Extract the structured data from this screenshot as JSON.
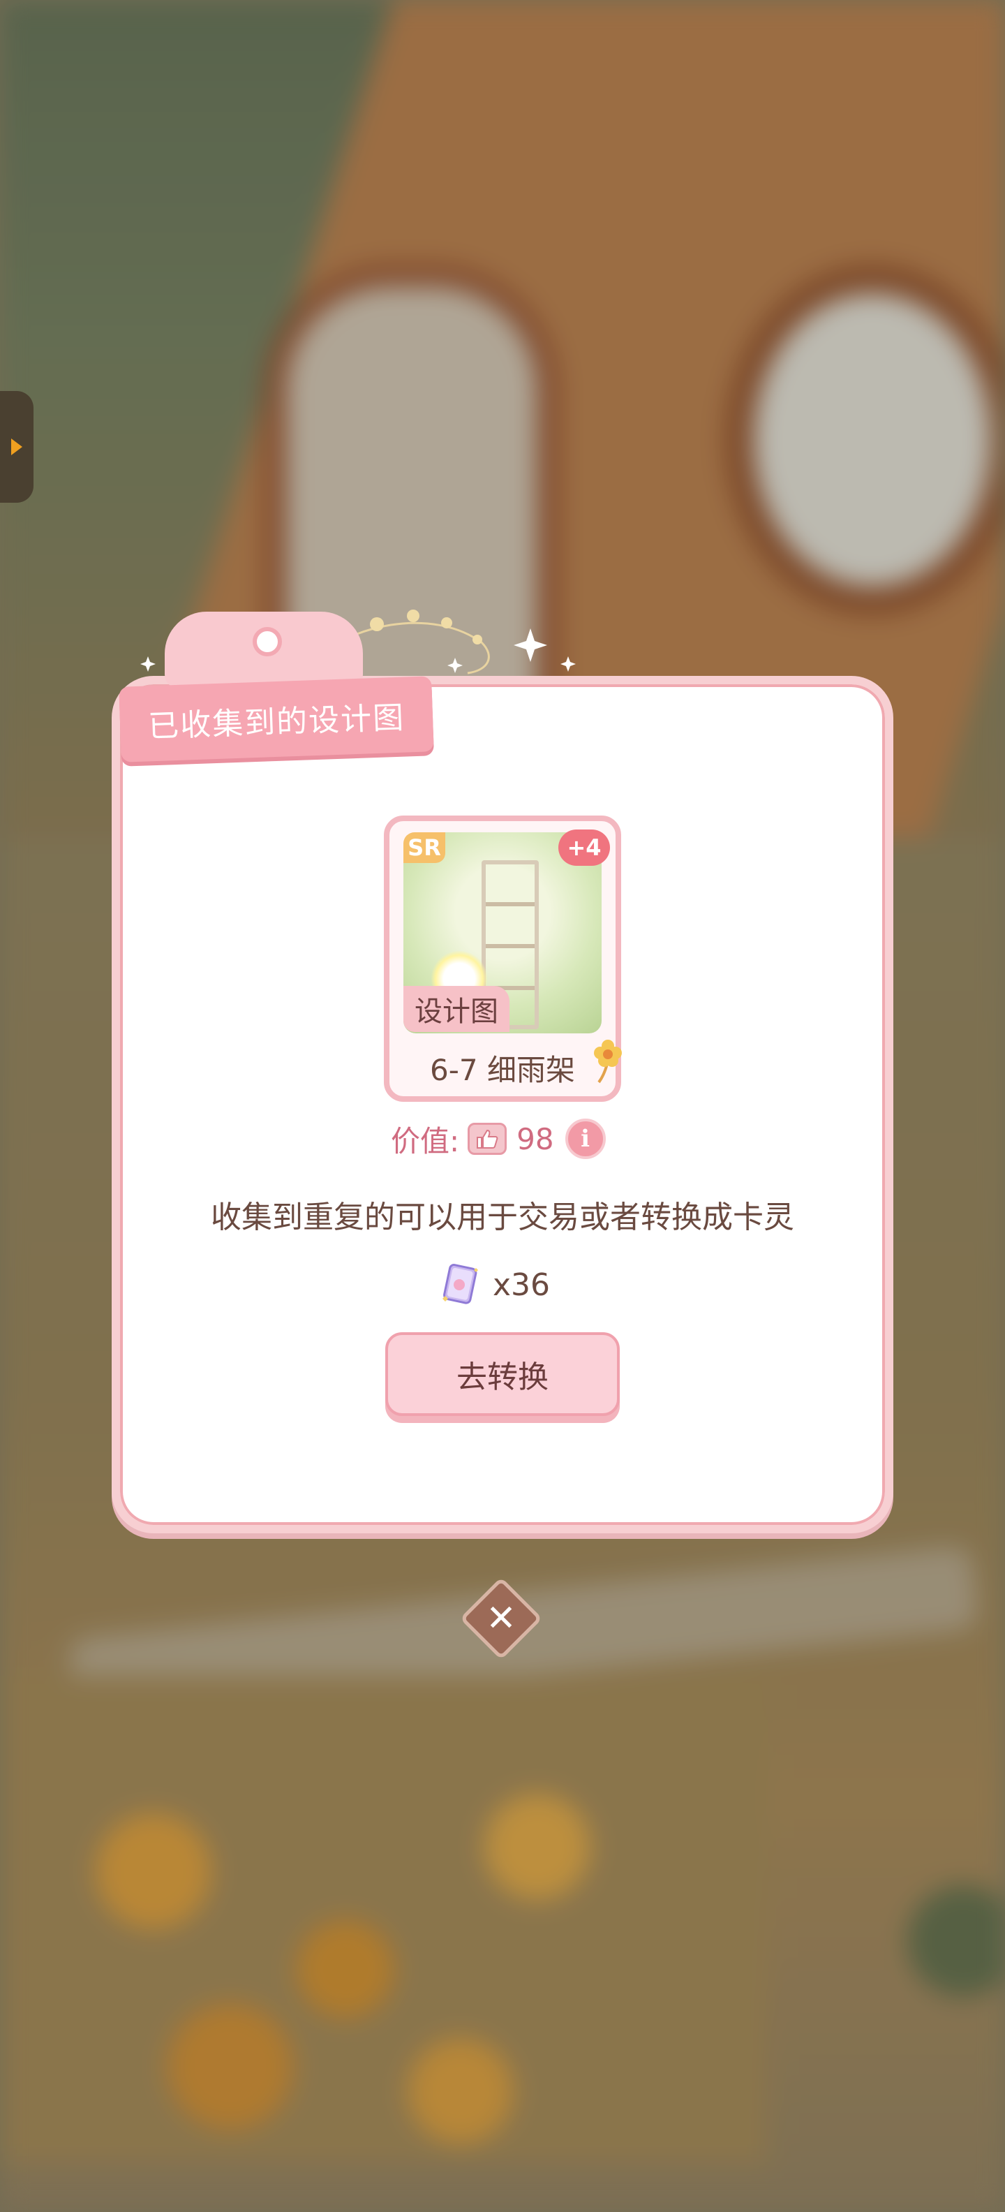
{
  "dialog": {
    "title": "已收集到的设计图"
  },
  "blueprint_card": {
    "rarity": "SR",
    "extra_count": "+4",
    "type_label": "设计图",
    "name": "6-7 细雨架"
  },
  "value": {
    "label": "价值:",
    "amount": "98"
  },
  "description": "收集到重复的可以用于交易或者转换成卡灵",
  "card_spirit": {
    "count": "x36"
  },
  "actions": {
    "convert_label": "去转换"
  },
  "colors": {
    "accent_pink": "#f6a6b2",
    "text_pink": "#d06b80",
    "text_brown": "#6a4a40",
    "badge_red": "#f0747f",
    "badge_gold": "#f6c06a"
  },
  "icons": {
    "side_tab": "chevron-right-icon",
    "value_currency": "thumbs-up-icon",
    "info": "info-icon",
    "card_spirit": "card-spirit-icon",
    "close": "close-icon",
    "flower": "flower-icon"
  }
}
